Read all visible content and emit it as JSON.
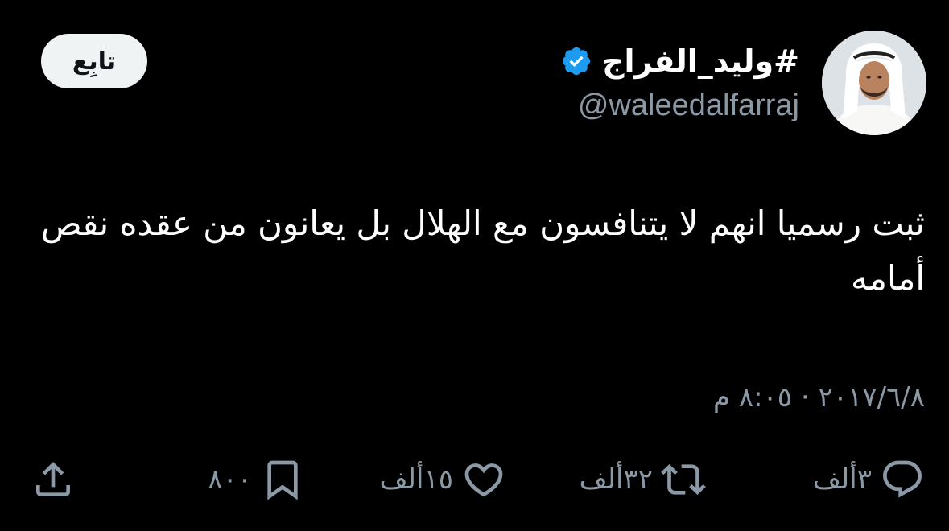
{
  "author": {
    "display_name": "#وليد_الفراج",
    "handle": "@waleedalfarraj",
    "verified": true,
    "avatar_icon": "person-avatar"
  },
  "follow_button": {
    "label": "تابِع"
  },
  "tweet": {
    "text": "ثبت رسميا انهم لا يتنافسون مع الهلال بل يعانون من عقده نقص أمامه",
    "timestamp": "٢٠١٧/٦/٨ · ٨:٠٥ م"
  },
  "actions": {
    "reply": {
      "icon": "reply-icon",
      "count": "٣ألف"
    },
    "retweet": {
      "icon": "retweet-icon",
      "count": "٣٢ألف"
    },
    "like": {
      "icon": "heart-icon",
      "count": "١٥ألف"
    },
    "bookmark": {
      "icon": "bookmark-icon",
      "count": "٨٠٠"
    },
    "share": {
      "icon": "share-icon"
    }
  },
  "colors": {
    "background": "#000000",
    "text_primary": "#ffffff",
    "text_secondary": "#8b98a5",
    "verified_blue": "#1d9bf0",
    "follow_button_bg": "#eff3f4"
  }
}
